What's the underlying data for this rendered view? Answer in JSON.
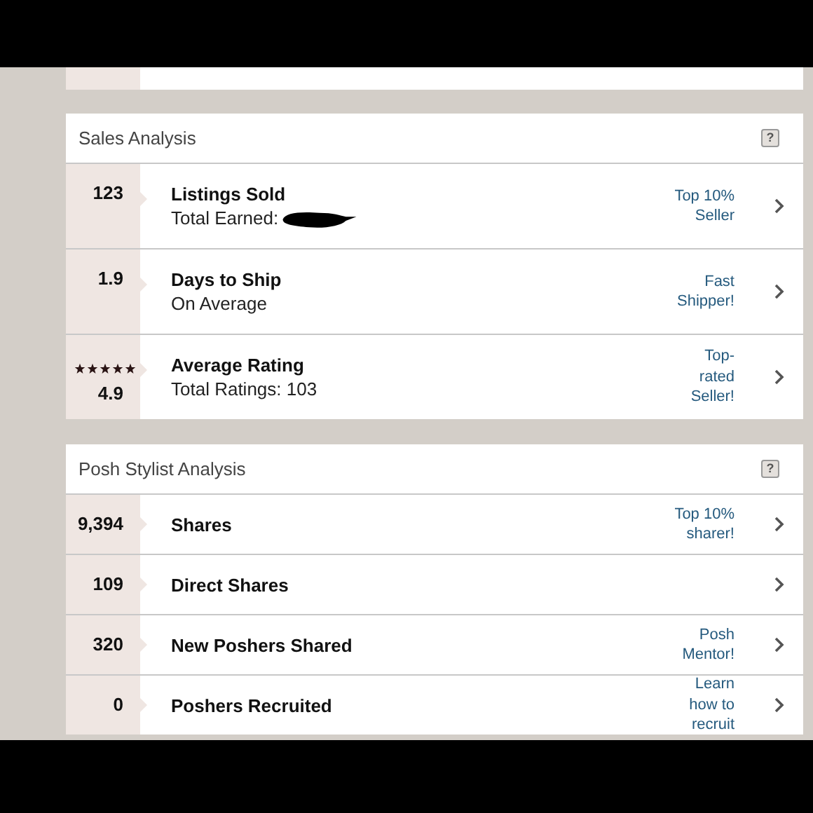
{
  "panels": [
    {
      "title": "Sales Analysis",
      "help": "?",
      "rows": [
        {
          "kind": "two-line",
          "value": "123",
          "label": "Listings Sold",
          "sublabel": "Total Earned:",
          "redacted": true,
          "badge": "Top 10%\nSeller"
        },
        {
          "kind": "two-line",
          "value": "1.9",
          "label": "Days to Ship",
          "sublabel": "On Average",
          "badge": "Fast\nShipper!"
        },
        {
          "kind": "two-line",
          "value": "4.9",
          "stars": 5,
          "label": "Average Rating",
          "sublabel": "Total Ratings: 103",
          "badge": "Top-\nrated\nSeller!"
        }
      ]
    },
    {
      "title": "Posh Stylist Analysis",
      "help": "?",
      "rows": [
        {
          "kind": "one-line",
          "value": "9,394",
          "label": "Shares",
          "badge": "Top 10%\nsharer!"
        },
        {
          "kind": "one-line",
          "value": "109",
          "label": "Direct Shares"
        },
        {
          "kind": "one-line",
          "value": "320",
          "label": "New Poshers Shared",
          "badge": "Posh\nMentor!"
        },
        {
          "kind": "one-line",
          "value": "0",
          "label": "Poshers Recruited",
          "badge": "Learn\nhow to\nrecruit"
        }
      ]
    }
  ]
}
